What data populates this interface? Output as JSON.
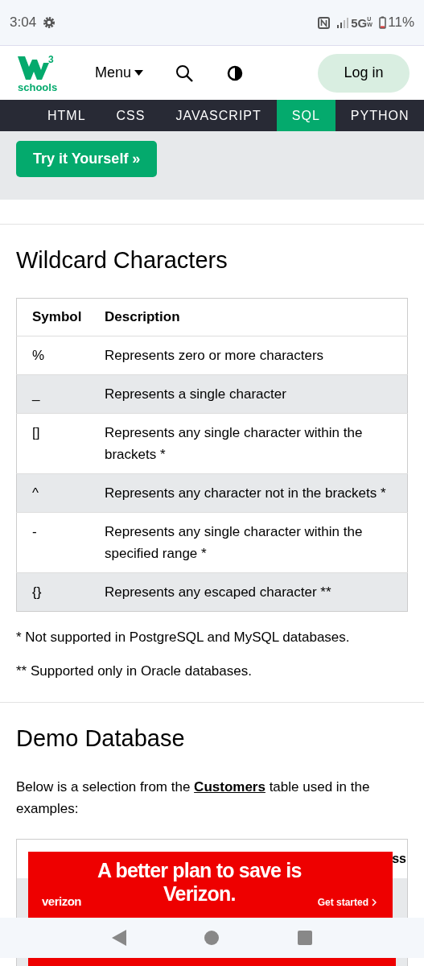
{
  "status_bar": {
    "time": "3:04",
    "network": "5G",
    "network_suffix": "UW",
    "battery": "11%"
  },
  "header": {
    "logo_text": "schools",
    "logo_sup": "3",
    "menu": "Menu",
    "login": "Log in"
  },
  "nav": [
    {
      "label": "HTML",
      "selected": false
    },
    {
      "label": "CSS",
      "selected": false
    },
    {
      "label": "JAVASCRIPT",
      "selected": false
    },
    {
      "label": "SQL",
      "selected": true
    },
    {
      "label": "PYTHON",
      "selected": false
    }
  ],
  "try_button": "Try it Yourself »",
  "wildcards": {
    "heading": "Wildcard Characters",
    "columns": [
      "Symbol",
      "Description"
    ],
    "rows": [
      [
        "%",
        "Represents zero or more characters"
      ],
      [
        "_",
        "Represents a single character"
      ],
      [
        "[]",
        "Represents any single character within the brackets *"
      ],
      [
        "^",
        "Represents any character not in the brackets *"
      ],
      [
        "-",
        "Represents any single character within the specified range *"
      ],
      [
        "{}",
        "Represents any escaped character **"
      ]
    ],
    "notes": [
      "* Not supported in PostgreSQL and MySQL databases.",
      "** Supported only in Oracle databases."
    ]
  },
  "demo": {
    "heading": "Demo Database",
    "intro": "Below is a selection from the **Customers** table used in the examples:",
    "column_fragment": "ss"
  },
  "ad": {
    "headline": "A better plan to save is Verizon.",
    "brand": "verizon",
    "cta": "Get started"
  }
}
